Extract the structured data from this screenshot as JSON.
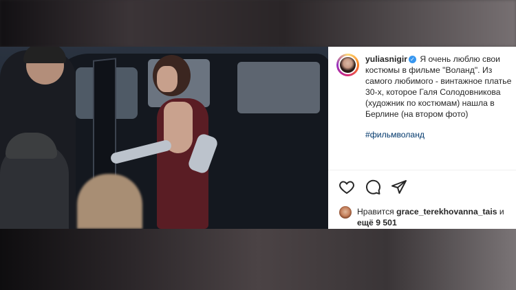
{
  "post": {
    "username": "yuliasnigir",
    "caption": "Я очень люблю свои костюмы в фильме \"Воланд\". Из самого любимого - винтажное платье 30-х, которое Галя Солодовникова (художник по костюмам) нашла в Берлине (на втором фото)",
    "hashtag": "#фильмволанд"
  },
  "actions": {
    "icons": [
      "heart-icon",
      "comment-icon",
      "share-icon"
    ]
  },
  "likes": {
    "prefix": "Нравится",
    "user": "grace_terekhovanna_tais",
    "middle": "и",
    "others": "ещё 9 501"
  }
}
